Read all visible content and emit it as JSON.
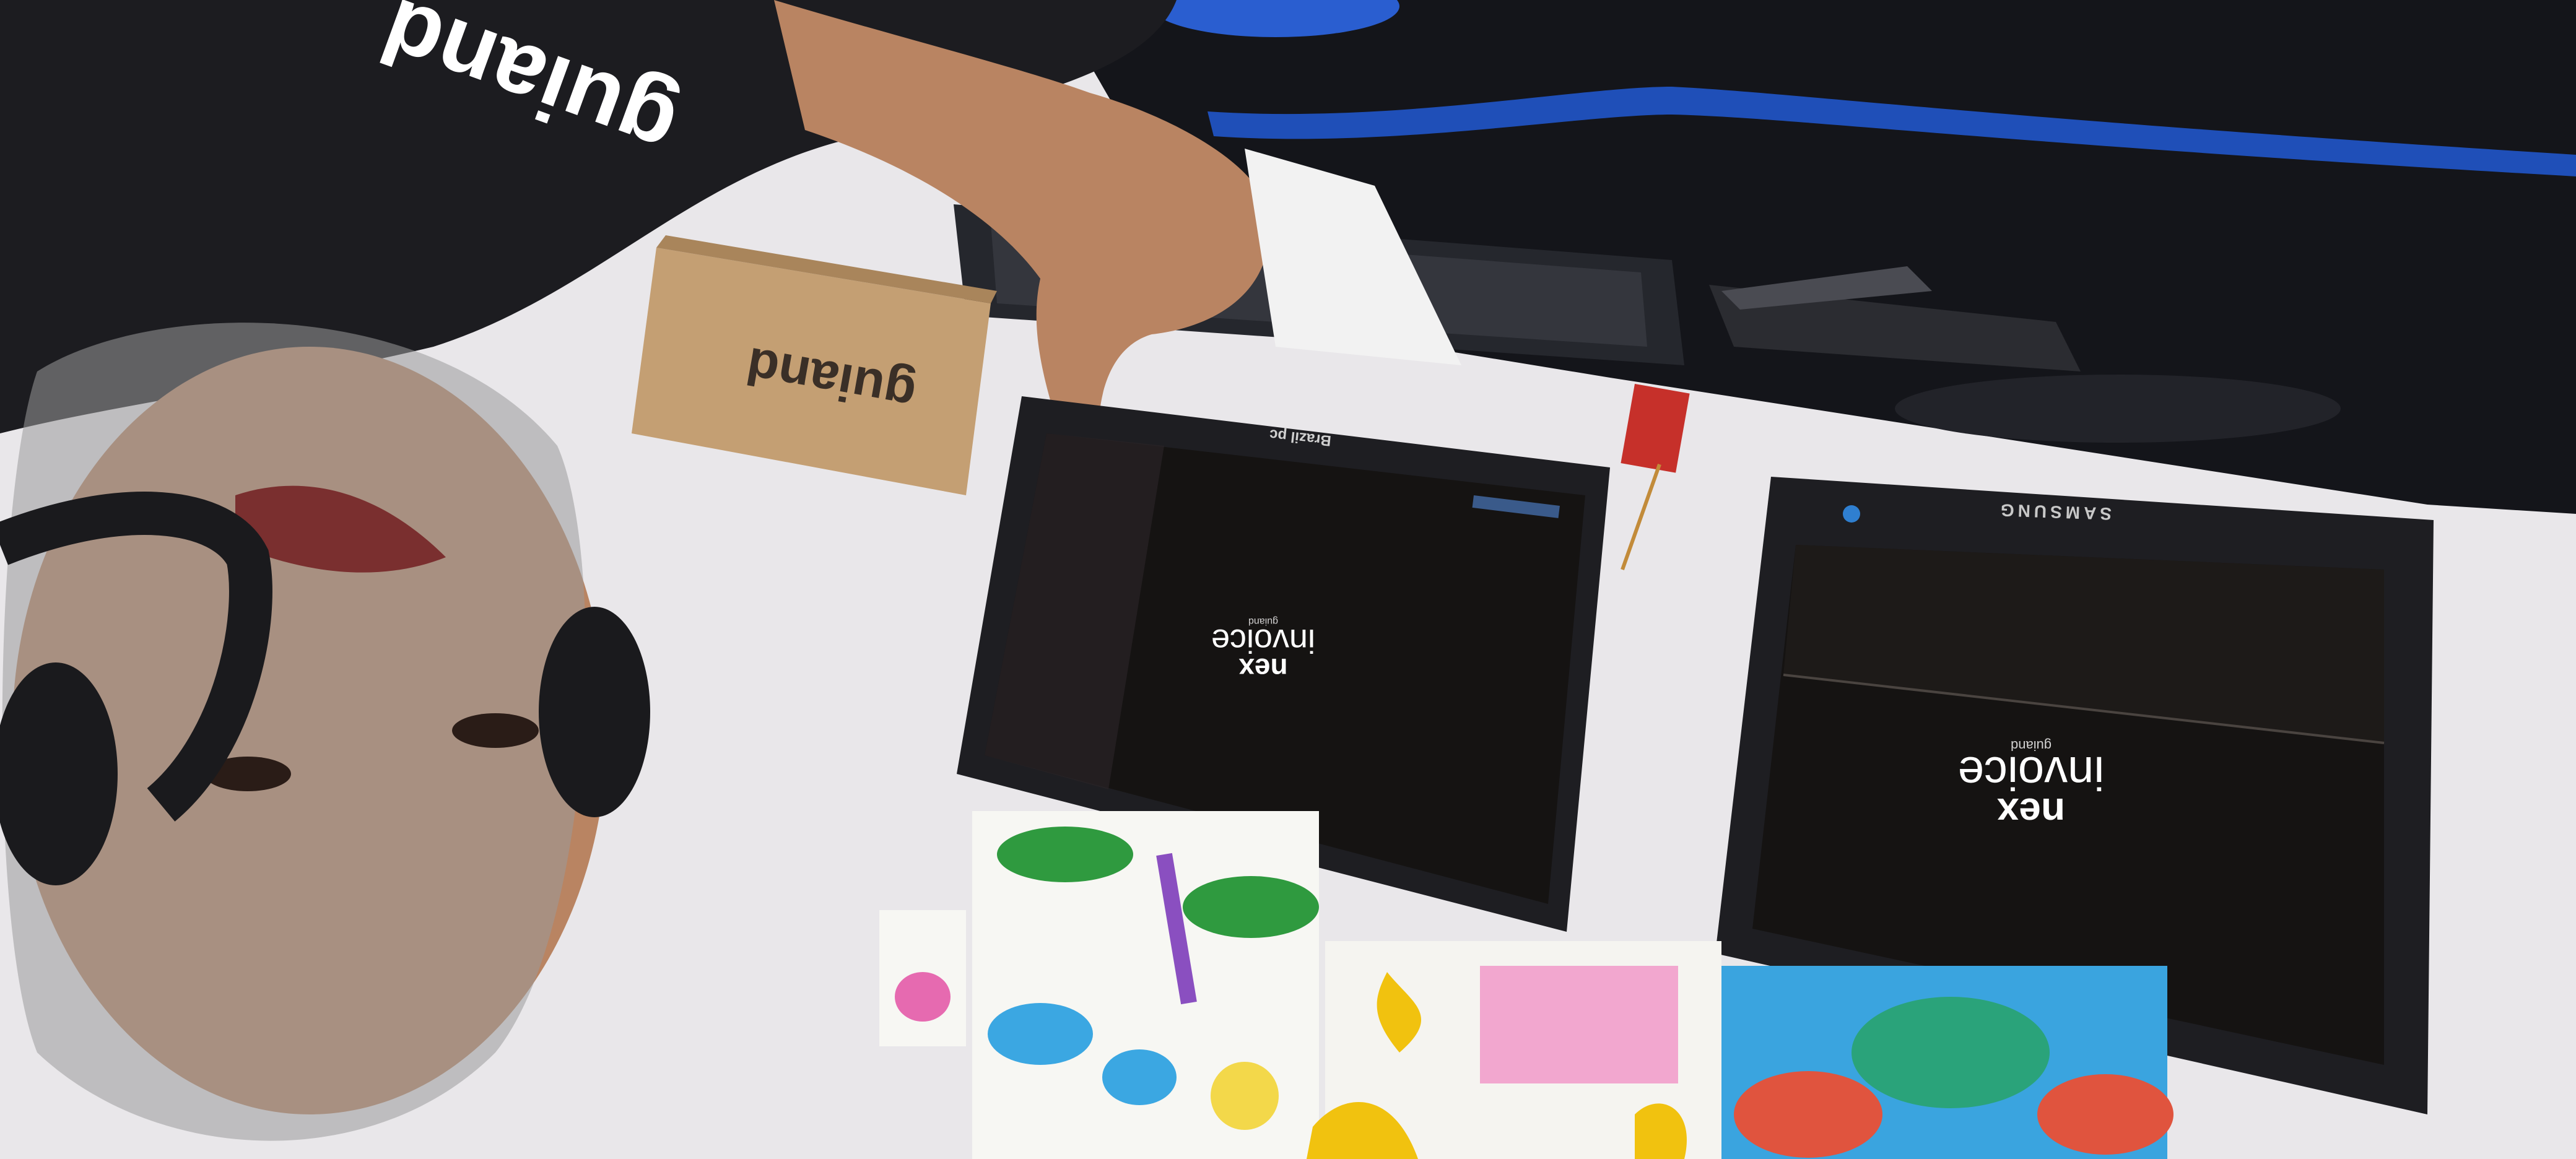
{
  "scene": {
    "colors": {
      "wall": "#e9e7ea",
      "desk_black": "#14151a",
      "desk_blue_trim": "#1f4fb8",
      "shirt": "#1c1c20",
      "skin": "#b98462",
      "hair": "#9a9a9a",
      "box": "#c49f73",
      "screen": "#151312",
      "monitor_bezel": "#1e1e22"
    }
  },
  "left_monitor": {
    "brand_line1": "nex",
    "brand_line2": "invoice",
    "brand_tagline": "guiand",
    "bezel_label": "Brazil pc"
  },
  "right_monitor": {
    "brand_line1": "nex",
    "brand_line2": "invoice",
    "brand_tagline": "guiand",
    "bezel_label": "SAMSUNG"
  },
  "box": {
    "label": "guiand"
  },
  "shirt": {
    "label": "guiand"
  }
}
